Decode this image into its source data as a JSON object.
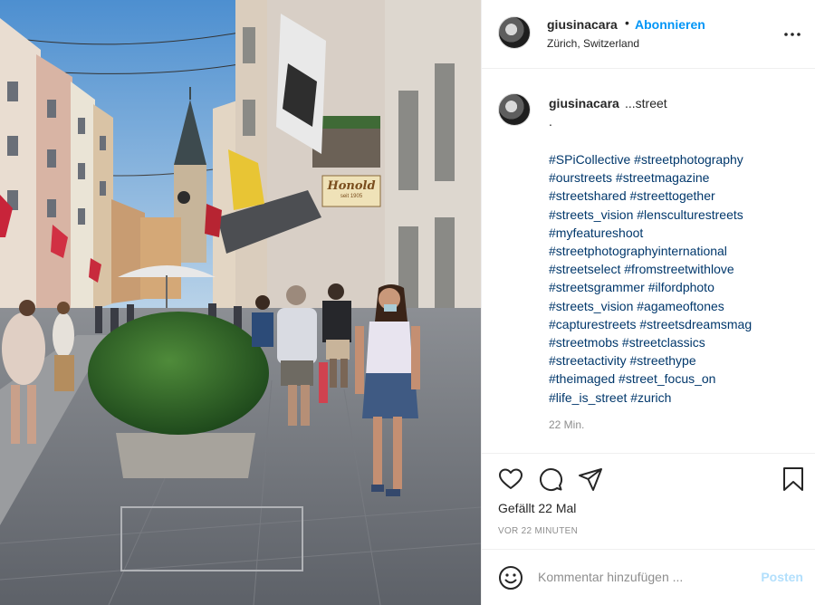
{
  "post": {
    "username": "giusinacara",
    "follow_separator": "•",
    "follow_label": "Abonnieren",
    "location": "Zürich, Switzerland",
    "more_icon": "more-horizontal-icon"
  },
  "photo": {
    "shop_sign": "Honold",
    "shop_sign_sub": "seit 1905"
  },
  "caption": {
    "username": "giusinacara",
    "first_line": "...street",
    "dot_line": ".",
    "hashtag_lines": [
      "#SPiCollective #streetphotography",
      "#ourstreets #streetmagazine",
      "#streetshared #streettogether",
      "#streets_vision #lensculturestreets",
      "#myfeatureshoot",
      "#streetphotographyinternational",
      "#streetselect #fromstreetwithlove",
      "#streetsgrammer #ilfordphoto",
      "#streets_vision #agameoftones",
      "#capturestreets #streetsdreamsmag",
      "#streetmobs #streetclassics",
      "#streetactivity #streethype",
      "#theimaged #street_focus_on",
      "#life_is_street #zurich"
    ],
    "time": "22 Min."
  },
  "actions": {
    "icons": [
      "heart-icon",
      "comment-icon",
      "share-icon",
      "bookmark-icon"
    ],
    "likes": "Gefällt 22 Mal",
    "posted_ago": "VOR 22 MINUTEN"
  },
  "comment": {
    "placeholder": "Kommentar hinzufügen ...",
    "post_label": "Posten",
    "emoji_icon": "emoji-icon"
  },
  "colors": {
    "link": "#0095f6",
    "hashtag": "#00376b",
    "secondary": "#8e8e8e",
    "post_disabled": "#b2dffc"
  }
}
